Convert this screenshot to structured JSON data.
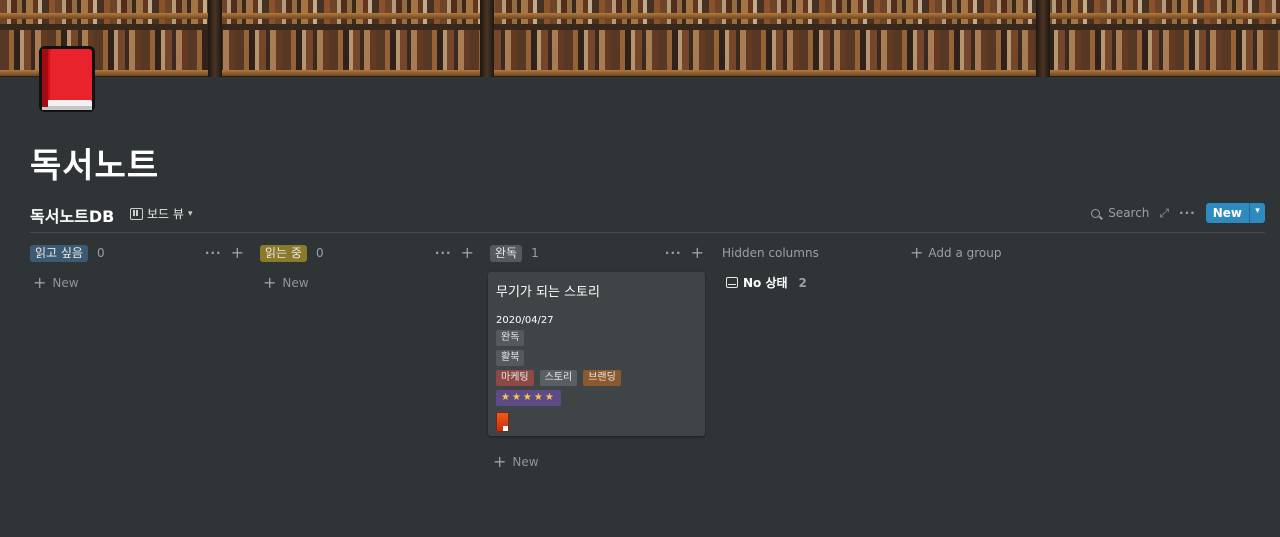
{
  "page": {
    "title": "독서노트",
    "icon": "red-book-icon"
  },
  "database": {
    "title": "독서노트DB",
    "view_label": "보드 뷰",
    "search_label": "Search",
    "new_label": "New"
  },
  "columns": [
    {
      "label": "읽고 싶음",
      "count": "0",
      "color": "#3d5a73",
      "new_label": "New"
    },
    {
      "label": "읽는 중",
      "count": "0",
      "color": "#8c7a2b",
      "new_label": "New"
    },
    {
      "label": "완독",
      "count": "1",
      "color": "#545a5e",
      "new_label": "New"
    }
  ],
  "card": {
    "title": "무기가 되는 스토리",
    "date": "2020/04/27",
    "status": "완독",
    "format": "활북",
    "tags": [
      {
        "label": "마케팅",
        "color": "#8d4a45"
      },
      {
        "label": "스토리",
        "color": "#5a5f63"
      },
      {
        "label": "브랜딩",
        "color": "#8a5a2e"
      }
    ],
    "rating": "★★★★★",
    "rating_color": "#5d4a86"
  },
  "hidden": {
    "label": "Hidden columns",
    "group_label": "No 상태",
    "group_count": "2"
  },
  "add_group_label": "Add a group",
  "colors": {
    "background": "#2f3437",
    "accent": "#2e8bc0",
    "card": "#3f4447"
  }
}
